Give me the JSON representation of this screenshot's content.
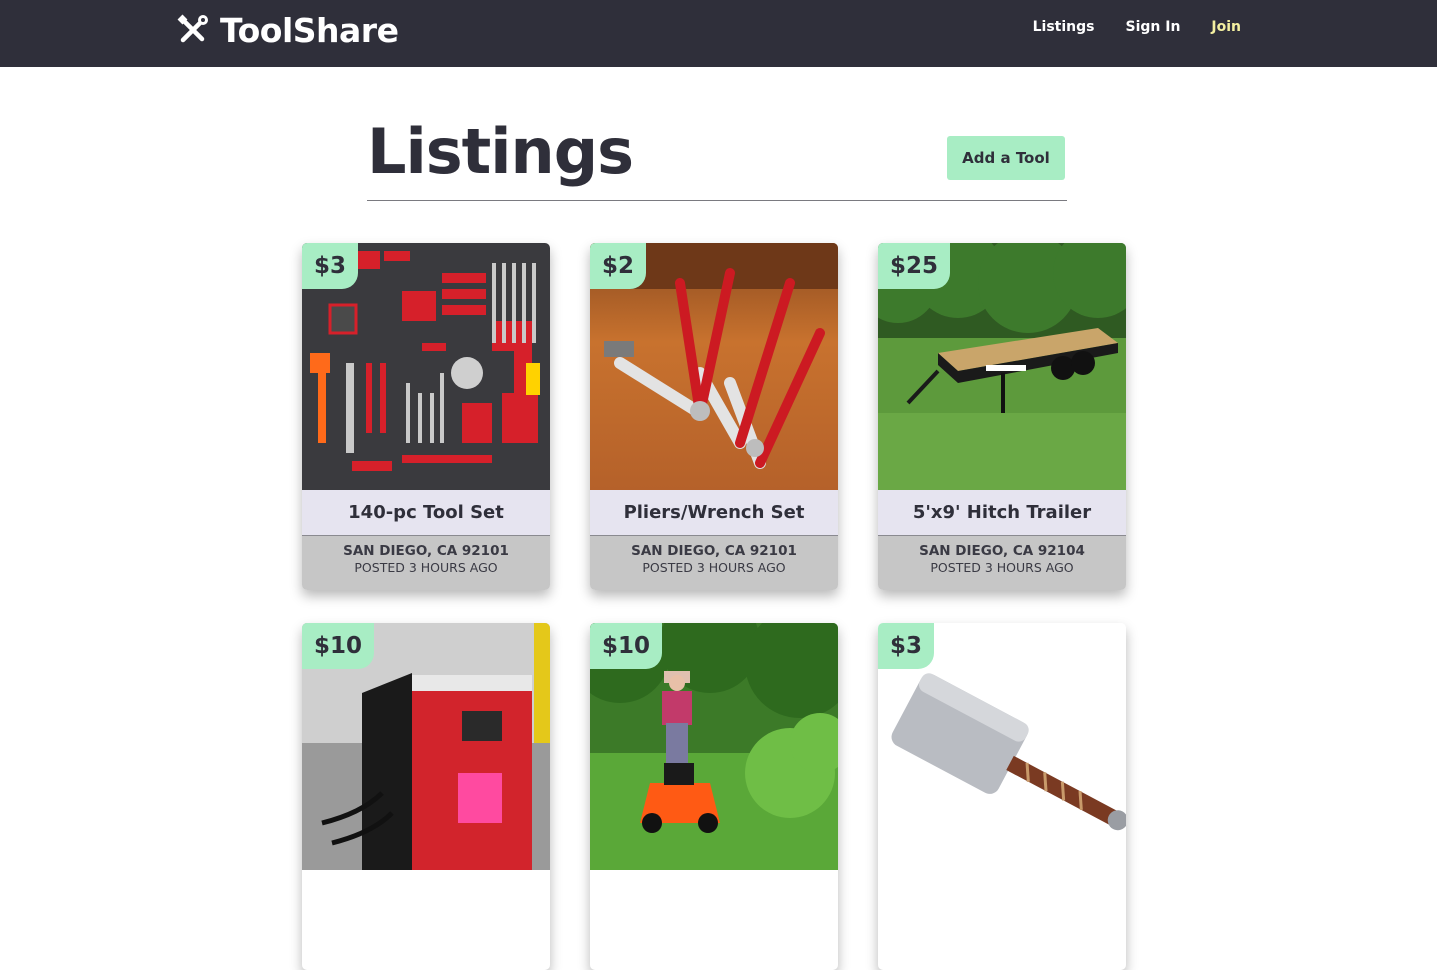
{
  "nav": {
    "brand": "ToolShare",
    "links": [
      "Listings",
      "Sign In",
      "Join"
    ]
  },
  "page": {
    "title": "Listings",
    "add_button": "Add a Tool"
  },
  "listings": [
    {
      "price": "$3",
      "title": "140-pc Tool Set",
      "location": "SAN DIEGO, CA 92101",
      "posted": "POSTED 3 HOURS AGO"
    },
    {
      "price": "$2",
      "title": "Pliers/Wrench Set",
      "location": "SAN DIEGO, CA 92101",
      "posted": "POSTED 3 HOURS AGO"
    },
    {
      "price": "$25",
      "title": "5'x9' Hitch Trailer",
      "location": "SAN DIEGO, CA 92104",
      "posted": "POSTED 3 HOURS AGO"
    },
    {
      "price": "$10",
      "title": "",
      "location": "",
      "posted": ""
    },
    {
      "price": "$10",
      "title": "",
      "location": "",
      "posted": ""
    },
    {
      "price": "$3",
      "title": "",
      "location": "",
      "posted": ""
    }
  ],
  "icons": {
    "brand": "crossed-tools-icon"
  },
  "colors": {
    "navbar": "#2f2f3a",
    "accent": "#a8edc4",
    "join": "#f4f0a0",
    "card_title_bg": "#e6e4f0",
    "card_meta_bg": "#c6c6c6"
  }
}
